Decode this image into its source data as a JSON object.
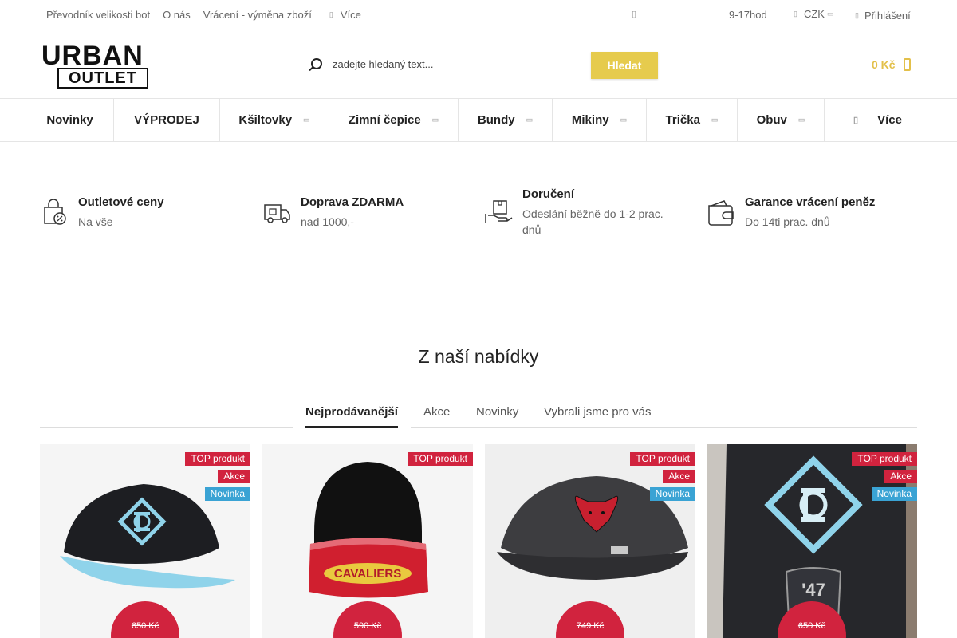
{
  "topbar": {
    "links": [
      "Převodník velikosti bot",
      "O nás",
      "Vrácení - výměna zboží"
    ],
    "more_label": "Více",
    "hours": "9-17hod",
    "currency": "CZK",
    "login_label": "Přihlášení"
  },
  "header": {
    "logo_line1": "URBAN",
    "logo_line2": "OUTLET",
    "search_placeholder": "zadejte hledaný text...",
    "search_button": "Hledat",
    "cart_total": "0 Kč",
    "accent_color": "#e6cb4d"
  },
  "nav": {
    "items": [
      {
        "label": "Novinky",
        "dropdown": false
      },
      {
        "label": "VÝPRODEJ",
        "dropdown": false
      },
      {
        "label": "Kšiltovky",
        "dropdown": true
      },
      {
        "label": "Zimní čepice",
        "dropdown": true
      },
      {
        "label": "Bundy",
        "dropdown": true
      },
      {
        "label": "Mikiny",
        "dropdown": true
      },
      {
        "label": "Trička",
        "dropdown": true
      },
      {
        "label": "Obuv",
        "dropdown": true
      },
      {
        "label": "Více",
        "dropdown": false
      }
    ]
  },
  "benefits": [
    {
      "title": "Outletové ceny",
      "subtitle": "Na vše",
      "icon": "discount-bag-icon"
    },
    {
      "title": "Doprava ZDARMA",
      "subtitle": "nad 1000,-",
      "icon": "delivery-truck-icon"
    },
    {
      "title": "Doručení",
      "subtitle": "Odeslání běžně do 1-2 prac. dnů",
      "icon": "package-hand-icon"
    },
    {
      "title": "Garance vrácení peněz",
      "subtitle": "Do 14ti prac. dnů",
      "icon": "wallet-icon"
    }
  ],
  "section": {
    "title": "Z naší nabídky",
    "tabs": [
      "Nejprodávanější",
      "Akce",
      "Novinky",
      "Vybrali jsme pro vás"
    ],
    "active_tab": "Nejprodávanější"
  },
  "products": [
    {
      "badges": [
        "TOP produkt",
        "Akce",
        "Novinka"
      ],
      "old_price": "650 Kč",
      "image": "black-cap-light-blue-brim"
    },
    {
      "badges": [
        "TOP produkt"
      ],
      "old_price": "590 Kč",
      "image": "cavaliers-beanie"
    },
    {
      "badges": [
        "TOP produkt",
        "Akce",
        "Novinka"
      ],
      "old_price": "749 Kč",
      "image": "bulls-grey-cap"
    },
    {
      "badges": [
        "TOP produkt",
        "Akce",
        "Novinka"
      ],
      "old_price": "650 Kč",
      "image": "black-cap-photo"
    }
  ],
  "colors": {
    "badge_red": "#d1233e",
    "badge_blue": "#3aa3d4"
  }
}
